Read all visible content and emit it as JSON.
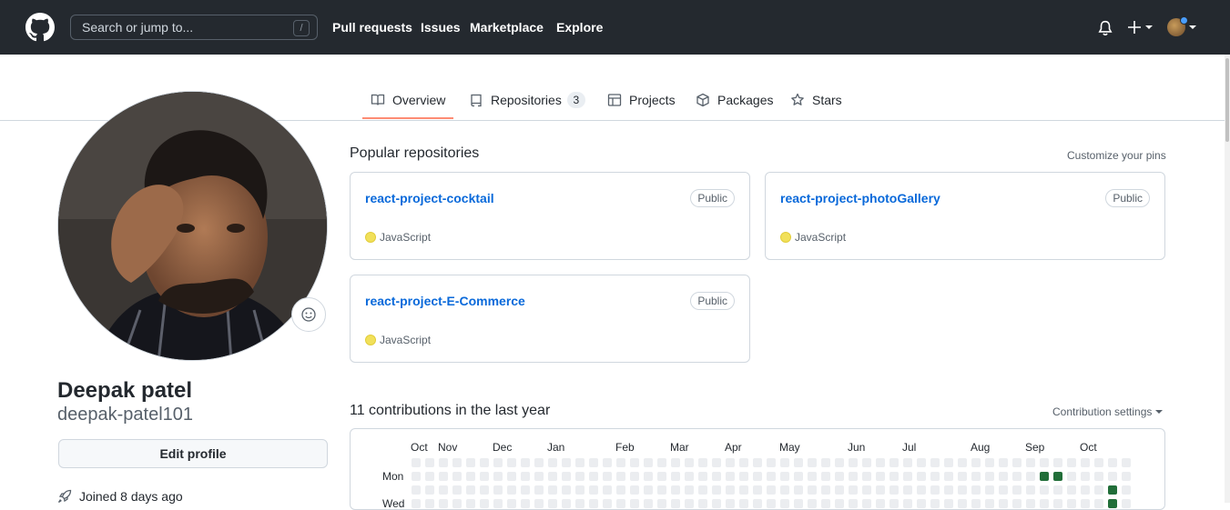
{
  "header": {
    "search_placeholder": "Search or jump to...",
    "search_shortcut": "/",
    "nav": [
      "Pull requests",
      "Issues",
      "Marketplace",
      "Explore"
    ]
  },
  "tabs": [
    {
      "label": "Overview",
      "active": true,
      "icon": "book-icon"
    },
    {
      "label": "Repositories",
      "count": "3",
      "icon": "repo-icon"
    },
    {
      "label": "Projects",
      "icon": "table-icon"
    },
    {
      "label": "Packages",
      "icon": "package-icon"
    },
    {
      "label": "Stars",
      "icon": "star-icon"
    }
  ],
  "profile": {
    "name": "Deepak patel",
    "username": "deepak-patel101",
    "edit_label": "Edit profile",
    "joined": "Joined 8 days ago"
  },
  "popular": {
    "title": "Popular repositories",
    "customize": "Customize your pins",
    "repos": [
      {
        "name": "react-project-cocktail",
        "visibility": "Public",
        "language": "JavaScript"
      },
      {
        "name": "react-project-photoGallery",
        "visibility": "Public",
        "language": "JavaScript"
      },
      {
        "name": "react-project-E-Commerce",
        "visibility": "Public",
        "language": "JavaScript"
      }
    ]
  },
  "contributions": {
    "title": "11 contributions in the last year",
    "settings": "Contribution settings",
    "months": [
      "Oct",
      "Nov",
      "Dec",
      "Jan",
      "Feb",
      "Mar",
      "Apr",
      "May",
      "Jun",
      "Jul",
      "Aug",
      "Sep",
      "Oct"
    ],
    "days": [
      "Mon",
      "Wed"
    ]
  },
  "colors": {
    "header_bg": "#24292f",
    "link": "#0969da",
    "tab_underline": "#fd8c73",
    "javascript": "#f1e05a",
    "contribution_level_1": "#216e39"
  }
}
